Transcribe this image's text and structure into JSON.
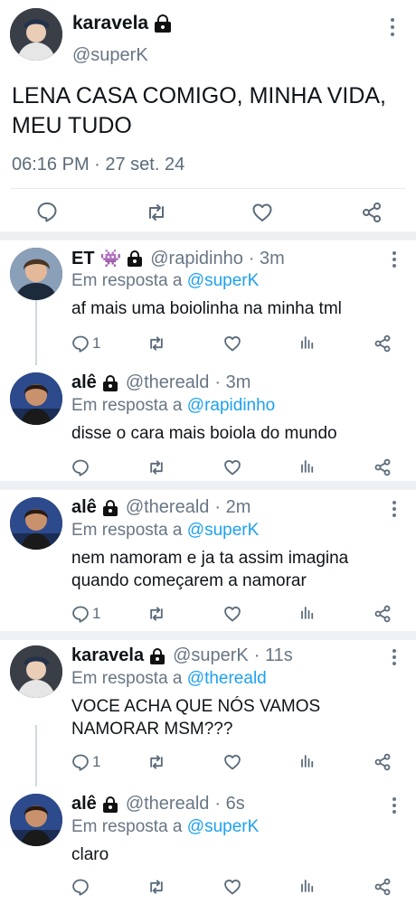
{
  "main_tweet": {
    "display_name": "karavela",
    "handle": "@superK",
    "text": "LENA CASA COMIGO, MINHA VIDA, MEU TUDO",
    "timestamp": "06:16 PM · 27 set. 24"
  },
  "replies": [
    {
      "display_name": "ET",
      "emoji": "👾",
      "handle": "@rapidinho",
      "time": "· 3m",
      "reply_prefix": "Em resposta a",
      "reply_to": "@superK",
      "text": "af mais uma boiolinha na minha tml",
      "reply_count": "1"
    },
    {
      "display_name": "alê",
      "handle": "@thereald",
      "time": "· 3m",
      "reply_prefix": "Em resposta a",
      "reply_to": "@rapidinho",
      "text": "disse o cara mais boiola do mundo",
      "reply_count": ""
    },
    {
      "display_name": "alê",
      "handle": "@thereald",
      "time": "· 2m",
      "reply_prefix": "Em resposta a",
      "reply_to": "@superK",
      "text": "nem namoram e ja ta assim imagina quando começarem a namorar",
      "reply_count": "1"
    },
    {
      "display_name": "karavela",
      "handle": "@superK",
      "time": "· 11s",
      "reply_prefix": "Em resposta a",
      "reply_to": "@thereald",
      "text": "VOCE ACHA QUE NÓS VAMOS NAMORAR MSM???",
      "reply_count": "1"
    },
    {
      "display_name": "alê",
      "handle": "@thereald",
      "time": "· 6s",
      "reply_prefix": "Em resposta a",
      "reply_to": "@superK",
      "text": "claro",
      "reply_count": ""
    }
  ],
  "icons": {
    "reply": "reply-icon",
    "retweet": "retweet-icon",
    "like": "heart-icon",
    "stats": "stats-icon",
    "share": "share-icon",
    "more": "more-icon",
    "lock": "lock-icon"
  },
  "colors": {
    "mention": "#1da1f2",
    "secondary_text": "#687684",
    "icon": "#5b6b7a",
    "thread_line": "#cfd9de",
    "separator": "#eef1f4"
  }
}
